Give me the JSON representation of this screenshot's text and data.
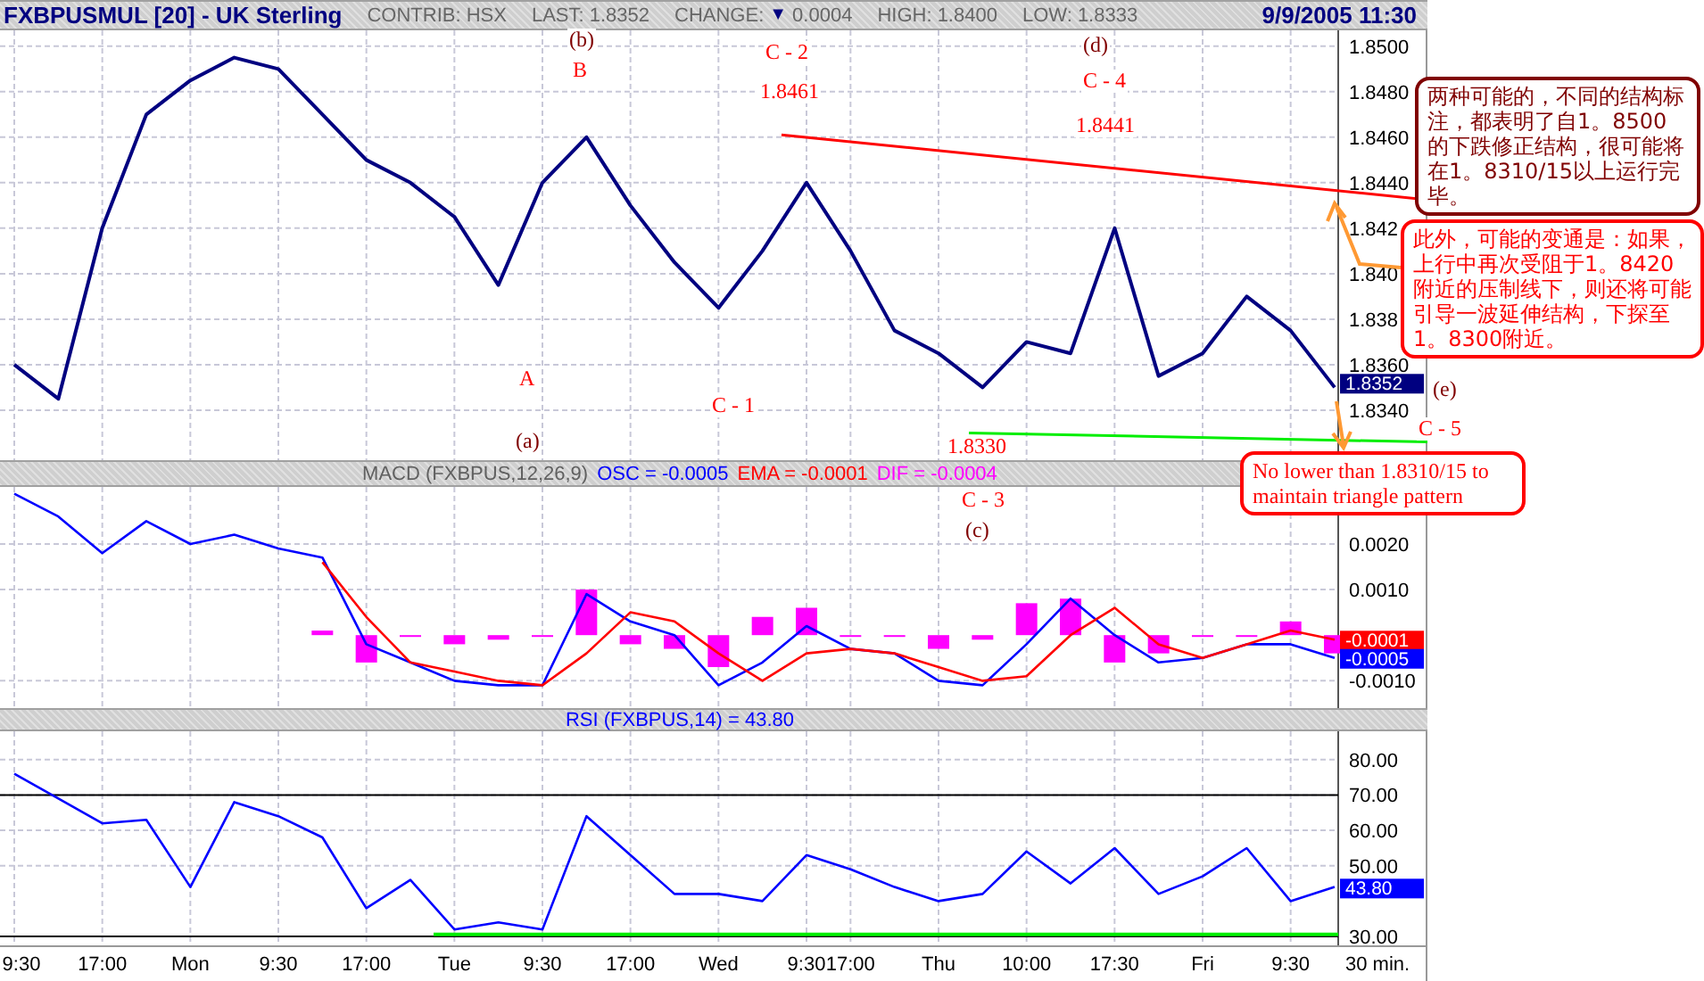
{
  "header": {
    "title_rest": "[20] - UK Sterling",
    "contrib": "CONTRIB: HSX",
    "last": "LAST: 1.8352",
    "change_label": "CHANGE:",
    "change_arrow": "▼",
    "change_value": "0.0004",
    "high": "HIGH: 1.8400",
    "low": "LOW: 1.8333",
    "datetime": "9/9/2005 11:30"
  },
  "price_chart": {
    "chart_data": {
      "type": "line",
      "grid": true,
      "categories": [
        null,
        null,
        null,
        null,
        null,
        null,
        null,
        null,
        null,
        null,
        null,
        null,
        null,
        null,
        null,
        null,
        null,
        null,
        null,
        null,
        null,
        null,
        null,
        null,
        null,
        null,
        null,
        null,
        null,
        null,
        null
      ],
      "ylim": [
        1.8318,
        1.8507
      ],
      "series": [
        {
          "name": "FXBPUSMUL",
          "color": "#000080",
          "values": [
            1.836,
            1.8345,
            1.842,
            1.847,
            1.8485,
            1.8495,
            1.849,
            1.847,
            1.845,
            1.844,
            1.8425,
            1.8395,
            1.844,
            1.846,
            1.843,
            1.8405,
            1.8385,
            1.841,
            1.844,
            1.841,
            1.8375,
            1.8365,
            1.835,
            1.837,
            1.8365,
            1.842,
            1.8355,
            1.8365,
            1.839,
            1.8375,
            1.835
          ]
        }
      ],
      "yticks": [
        {
          "value": 1.85,
          "label": "1.8500"
        },
        {
          "value": 1.848,
          "label": "1.8480"
        },
        {
          "value": 1.846,
          "label": "1.8460"
        },
        {
          "value": 1.844,
          "label": "1.8440"
        },
        {
          "value": 1.842,
          "label": "1.842"
        },
        {
          "value": 1.84,
          "label": "1.840"
        },
        {
          "value": 1.838,
          "label": "1.838"
        },
        {
          "value": 1.836,
          "label": "1.8360"
        },
        {
          "value": 1.834,
          "label": "1.8340"
        }
      ]
    },
    "value_tags": [
      {
        "text": "1.8352",
        "color": "#000080"
      }
    ]
  },
  "macd_title": "MACD (FXBPUS,12,26,9)",
  "macd_readings": [
    "= -0.0005",
    "= -0.0001",
    "= -0.0004"
  ],
  "macd_chart": {
    "chart_data": {
      "type": "line",
      "grid": true,
      "categories": [
        null,
        null,
        null,
        null,
        null,
        null,
        null,
        null,
        null,
        null,
        null,
        null,
        null,
        null,
        null,
        null,
        null,
        null,
        null,
        null,
        null,
        null,
        null,
        null,
        null,
        null,
        null,
        null,
        null,
        null,
        null
      ],
      "ylim": [
        -0.0016,
        0.00325
      ],
      "series": [
        {
          "name": "OSC",
          "color": "#0000ff",
          "values": [
            0.0031,
            0.0026,
            0.0018,
            0.0025,
            0.002,
            0.0022,
            0.0019,
            0.0017,
            -0.0002,
            -0.0006,
            -0.001,
            -0.0011,
            -0.0011,
            0.0009,
            0.0003,
            0.0,
            -0.0011,
            -0.0006,
            0.0002,
            -0.0003,
            -0.0004,
            -0.001,
            -0.0011,
            -0.0002,
            0.0008,
            0.0,
            -0.0006,
            -0.0005,
            -0.0002,
            -0.0002,
            -0.0005
          ]
        },
        {
          "name": "EMA",
          "color": "#ff0000",
          "values": [
            null,
            null,
            null,
            null,
            null,
            null,
            null,
            0.0016,
            0.0004,
            -0.0006,
            -0.0008,
            -0.001,
            -0.0011,
            -0.0004,
            0.0005,
            0.0003,
            -0.0004,
            -0.001,
            -0.0004,
            -0.0003,
            -0.0004,
            -0.0007,
            -0.001,
            -0.0009,
            0.0,
            0.0006,
            -0.0002,
            -0.0005,
            -0.0002,
            0.0001,
            -0.0001
          ]
        },
        {
          "name": "DIF",
          "type": "bar",
          "color": "#ff00ff",
          "values": [
            null,
            null,
            null,
            null,
            null,
            null,
            null,
            0.0001,
            -0.0006,
            0.0,
            -0.0002,
            -0.0001,
            0.0,
            0.001,
            -0.0002,
            -0.0003,
            -0.0007,
            0.0004,
            0.0006,
            0.0,
            0.0,
            -0.0003,
            -0.0001,
            0.0007,
            0.0008,
            -0.0006,
            -0.0004,
            0.0,
            0.0,
            0.0003,
            -0.0004
          ]
        }
      ],
      "yticks": [
        {
          "value": 0.002,
          "label": "0.0020"
        },
        {
          "value": 0.001,
          "label": "0.0010"
        },
        {
          "value": -0.001,
          "label": "-0.0010"
        }
      ]
    },
    "value_tags": [
      {
        "text": "-0.0001",
        "color": "#ff0000"
      },
      {
        "text": "-0.0005",
        "color": "#0000ff"
      }
    ]
  },
  "rsi_reading": "(FXBPUS,14) = 43.80",
  "rsi_chart": {
    "chart_data": {
      "type": "line",
      "grid": true,
      "categories": [
        "9:30",
        null,
        "17:00",
        null,
        "Mon",
        null,
        "9:30",
        null,
        "17:00",
        null,
        "Tue",
        null,
        "9:30",
        null,
        "17:00",
        null,
        "Wed",
        null,
        "9:30",
        "17:00",
        null,
        "Thu",
        null,
        "10:00",
        null,
        "17:30",
        null,
        "Fri",
        null,
        "9:30",
        null
      ],
      "ylim": [
        27.5,
        88
      ],
      "xlabel": "30 min.",
      "series": [
        {
          "name": "RSI",
          "color": "#0000ff",
          "values": [
            76,
            69,
            62,
            63,
            44,
            68,
            64,
            58,
            38,
            46,
            32,
            34,
            32,
            64,
            53,
            42,
            42,
            40,
            53,
            49,
            44,
            40,
            42,
            54,
            45,
            55,
            42,
            47,
            55,
            40,
            44
          ]
        }
      ],
      "yticks": [
        {
          "value": 80,
          "label": "80.00"
        },
        {
          "value": 70,
          "label": "70.00"
        },
        {
          "value": 60,
          "label": "60.00"
        },
        {
          "value": 50,
          "label": "50.00"
        },
        {
          "value": 30,
          "label": "30.00"
        }
      ]
    },
    "value_tags": [
      {
        "text": "43.80",
        "color": "#0000ff"
      }
    ]
  },
  "chart_labels": [
    {
      "text": "(b)",
      "color": "#800000"
    },
    {
      "text": "B",
      "color": "#ff0000"
    },
    {
      "text": "C - 2",
      "color": "#ff0000"
    },
    {
      "text": "1.8461",
      "color": "#ff0000"
    },
    {
      "text": "(d)",
      "color": "#800000"
    },
    {
      "text": "C - 4",
      "color": "#ff0000"
    },
    {
      "text": "1.8441",
      "color": "#ff0000"
    },
    {
      "text": "A",
      "color": "#ff0000"
    },
    {
      "text": "(a)",
      "color": "#800000"
    },
    {
      "text": "C - 1",
      "color": "#ff0000"
    },
    {
      "text": "1.8330",
      "color": "#ff0000"
    },
    {
      "text": "C - 3",
      "color": "#ff0000"
    },
    {
      "text": "(c)",
      "color": "#800000"
    },
    {
      "text": "(e)",
      "color": "#800000"
    },
    {
      "text": "C - 5",
      "color": "#ff0000"
    }
  ],
  "callouts": [
    {
      "text": "两种可能的，不同的结构标注，都表明了自1。8500的下跌修正结构，很可能将在1。8310/15以上运行完毕。",
      "color": "#800000"
    },
    {
      "text": "此外，可能的变通是：如果，上行中再次受阻于1。8420附近的压制线下，则还将可能引导一波延伸结构，下探至1。8300附近。",
      "color": "#ff0000"
    },
    {
      "text": "No lower than 1.8310/15 to maintain triangle pattern",
      "color": "#ff0000"
    }
  ]
}
